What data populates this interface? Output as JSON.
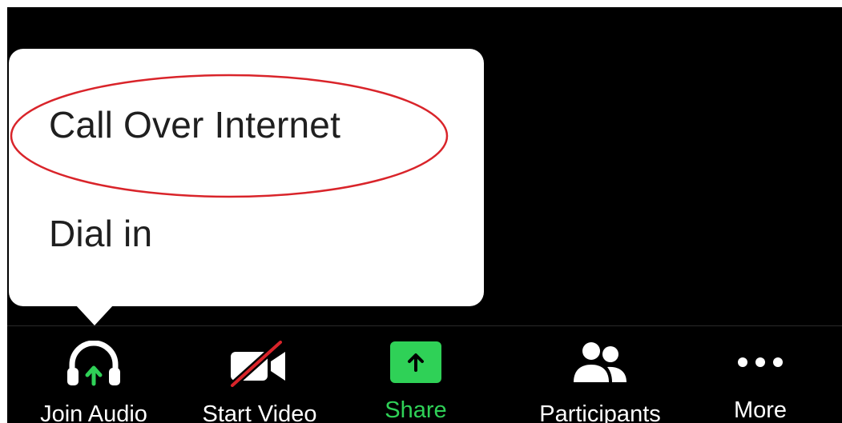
{
  "popup_menu": {
    "items": [
      {
        "label": "Call Over Internet",
        "highlighted": true
      },
      {
        "label": "Dial in",
        "highlighted": false
      }
    ],
    "highlight_color": "#d9242a"
  },
  "toolbar": {
    "items": [
      {
        "label": "Join Audio",
        "icon": "headphones-icon"
      },
      {
        "label": "Start Video",
        "icon": "video-off-icon"
      },
      {
        "label": "Share",
        "icon": "share-arrow-icon"
      },
      {
        "label": "Participants",
        "icon": "participants-icon"
      },
      {
        "label": "More",
        "icon": "more-dots-icon"
      }
    ]
  },
  "colors": {
    "background": "#000000",
    "accent_green": "#2fd157",
    "text_light": "#ffffff",
    "text_dark": "#1f1f1f",
    "video_slash": "#d9242a"
  }
}
